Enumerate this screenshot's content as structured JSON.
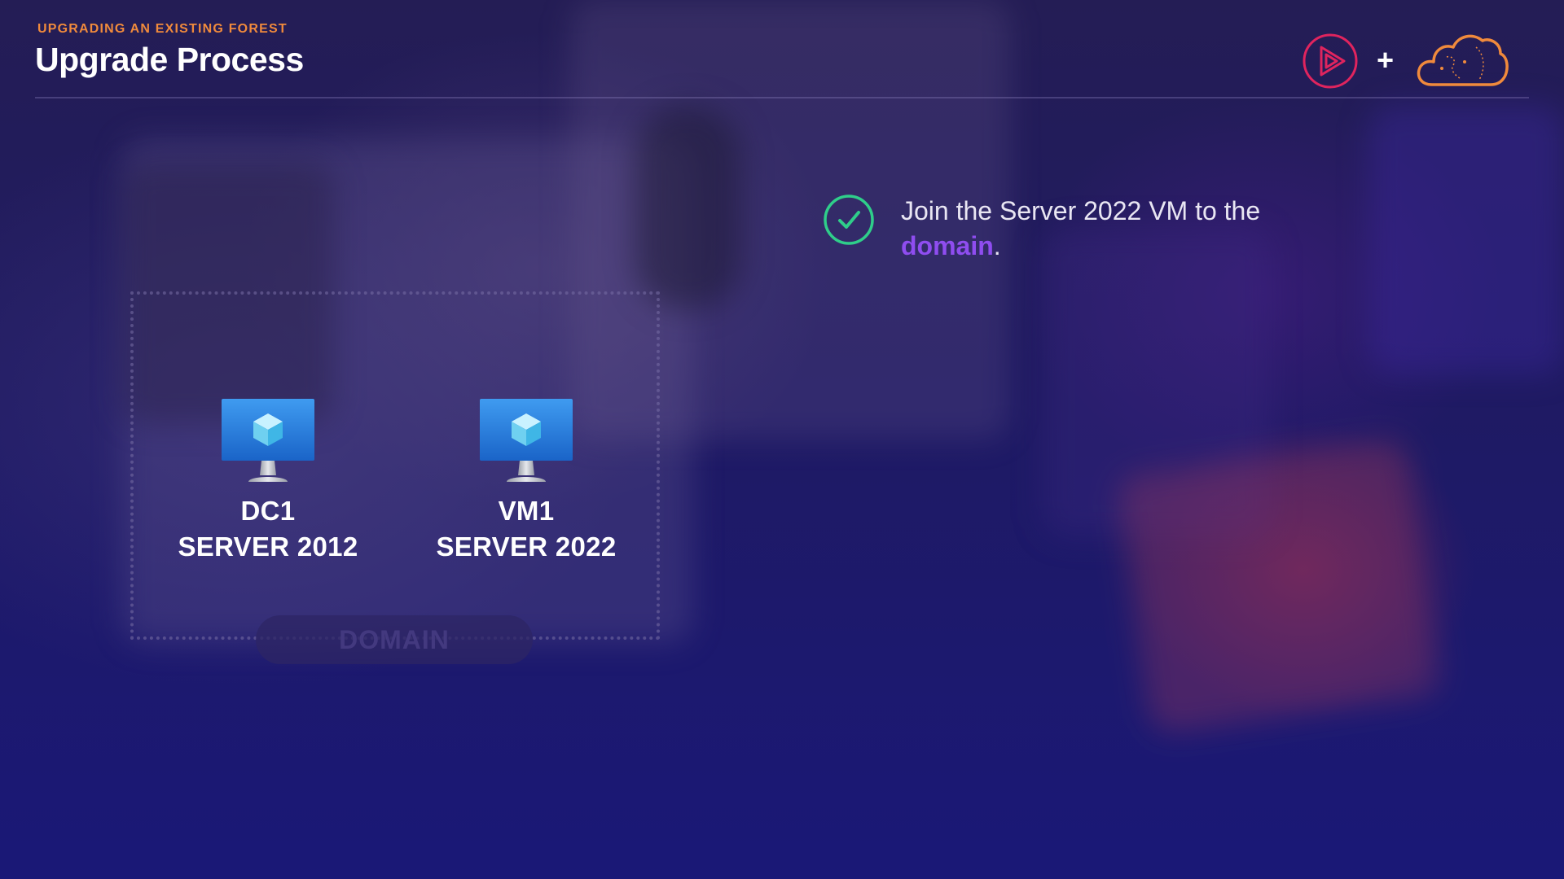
{
  "header": {
    "eyebrow": "UPGRADING AN EXISTING FOREST",
    "title": "Upgrade Process",
    "plus": "+"
  },
  "diagram": {
    "domain_label": "DOMAIN",
    "servers": [
      {
        "name": "DC1",
        "os": "SERVER 2012"
      },
      {
        "name": "VM1",
        "os": "SERVER 2022"
      }
    ]
  },
  "step": {
    "text_before": "Join the Server 2022 VM to the ",
    "highlight": "domain",
    "text_after": "."
  },
  "icons": {
    "check": "check-circle-icon",
    "server": "monitor-icon",
    "logo_left": "pluralsight-logo-icon",
    "logo_right": "cloud-logo-icon"
  },
  "colors": {
    "eyebrow": "#f08a3c",
    "highlight": "#8f4df0",
    "check": "#2fce8a",
    "logo_left": "#e0245e",
    "logo_right": "#f08a3c"
  }
}
